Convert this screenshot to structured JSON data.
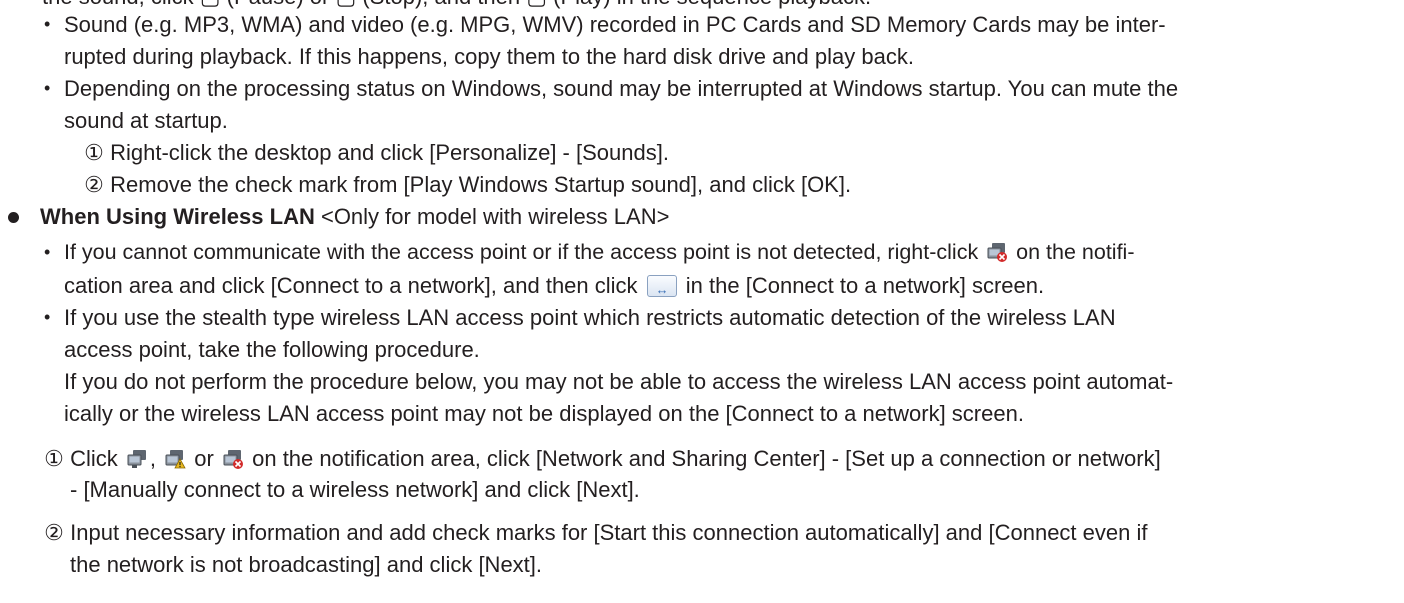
{
  "top_cut": "the sound, click ▢ (Pause) or ▢ (Stop), and then ▢ (Play) in the sequence playback.",
  "sound_notes": [
    {
      "line1": "Sound (e.g. MP3, WMA) and video (e.g. MPG, WMV) recorded in PC Cards and SD Memory Cards may be inter-",
      "line2": "rupted during playback. If this happens, copy them to the hard disk drive and play back."
    },
    {
      "line1": "Depending on the processing status on Windows, sound may be interrupted at Windows startup. You can mute the",
      "line2": "sound at startup."
    }
  ],
  "mute_steps": [
    {
      "num": "①",
      "text": "Right-click the desktop and click [Personalize] - [Sounds]."
    },
    {
      "num": "②",
      "text": "Remove the check mark from [Play Windows Startup sound], and click [OK]."
    }
  ],
  "wlan": {
    "heading": "When Using Wireless LAN",
    "note": "<Only for model with wireless LAN>",
    "item1": {
      "a": "If you cannot communicate with the access point or if the access point is not detected, right-click",
      "b": "on the notifi-",
      "c": "cation area and click [Connect to a network], and then click",
      "d": "in the [Connect to a network] screen."
    },
    "item2": {
      "line1": "If you use the stealth type wireless LAN access point which restricts automatic detection of the wireless LAN",
      "line2": "access point, take the following procedure.",
      "line3": "If you do not perform the procedure below, you may not be able to access the wireless LAN access point automat-",
      "line4": "ically or the wireless LAN access point may not be displayed on the [Connect to a network] screen."
    },
    "steps": {
      "s1_num": "①",
      "s1_a": "Click",
      "s1_comma": ",",
      "s1_or": "or",
      "s1_b": "on the notification area, click [Network and Sharing Center] - [Set up a connection or network]",
      "s1_c": "- [Manually connect to a wireless network] and click [Next].",
      "s2_num": "②",
      "s2_a": "Input necessary information and add check marks for [Start this connection automatically] and [Connect even if",
      "s2_b": "the network is not broadcasting] and click [Next]."
    }
  },
  "bullet_char": "•"
}
